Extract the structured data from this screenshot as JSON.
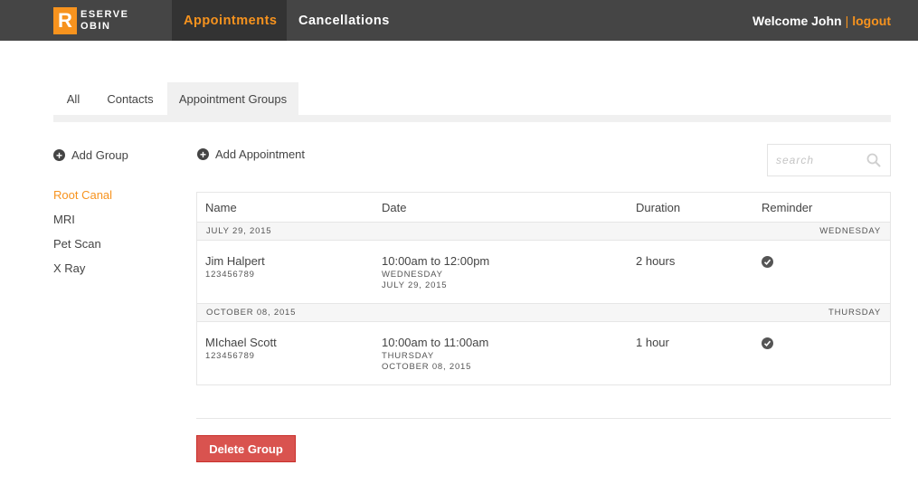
{
  "app": {
    "logo_letter": "R",
    "logo_line1": "ESERVE",
    "logo_line2": "OBIN",
    "accent_color": "#f7931e"
  },
  "nav": {
    "tabs": [
      {
        "label": "Appointments",
        "active": true
      },
      {
        "label": "Cancellations",
        "active": false
      }
    ],
    "welcome": "Welcome John",
    "separator": "|",
    "logout": "logout"
  },
  "subtabs": [
    {
      "label": "All",
      "active": false
    },
    {
      "label": "Contacts",
      "active": false
    },
    {
      "label": "Appointment Groups",
      "active": true
    }
  ],
  "sidebar": {
    "add_group": "Add Group",
    "groups": [
      {
        "label": "Root Canal",
        "active": true
      },
      {
        "label": "MRI",
        "active": false
      },
      {
        "label": "Pet Scan",
        "active": false
      },
      {
        "label": "X Ray",
        "active": false
      }
    ]
  },
  "main": {
    "add_appointment": "Add Appointment",
    "search_placeholder": "search",
    "columns": [
      "Name",
      "Date",
      "Duration",
      "Reminder"
    ],
    "groups": [
      {
        "date": "JULY 29, 2015",
        "weekday": "WEDNESDAY",
        "appointment": {
          "name": "Jim Halpert",
          "phone": "123456789",
          "time": "10:00am to 12:00pm",
          "day": "WEDNESDAY",
          "date": "JULY 29, 2015",
          "duration": "2 hours",
          "reminder": true
        }
      },
      {
        "date": "OCTOBER 08, 2015",
        "weekday": "THURSDAY",
        "appointment": {
          "name": "MIchael Scott",
          "phone": "123456789",
          "time": "10:00am to 11:00am",
          "day": "THURSDAY",
          "date": "OCTOBER 08, 2015",
          "duration": "1 hour",
          "reminder": true
        }
      }
    ],
    "delete_group": "Delete Group"
  }
}
